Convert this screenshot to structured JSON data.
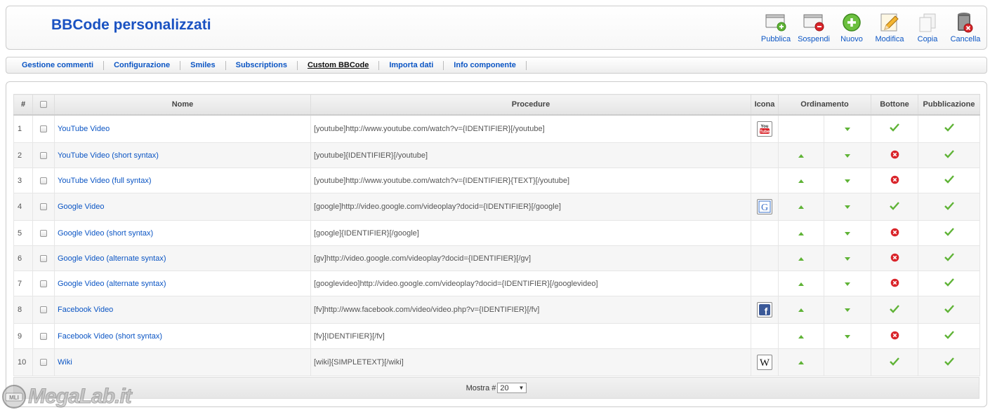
{
  "header": {
    "title": "BBCode personalizzati"
  },
  "toolbar": [
    {
      "label": "Pubblica",
      "icon": "publish-icon"
    },
    {
      "label": "Sospendi",
      "icon": "unpublish-icon"
    },
    {
      "label": "Nuovo",
      "icon": "new-icon"
    },
    {
      "label": "Modifica",
      "icon": "edit-icon"
    },
    {
      "label": "Copia",
      "icon": "copy-icon"
    },
    {
      "label": "Cancella",
      "icon": "delete-icon"
    }
  ],
  "tabs": [
    {
      "label": "Gestione commenti",
      "active": false
    },
    {
      "label": "Configurazione",
      "active": false
    },
    {
      "label": "Smiles",
      "active": false
    },
    {
      "label": "Subscriptions",
      "active": false
    },
    {
      "label": "Custom BBCode",
      "active": true
    },
    {
      "label": "Importa dati",
      "active": false
    },
    {
      "label": "Info componente",
      "active": false
    }
  ],
  "table": {
    "headers": {
      "num": "#",
      "name": "Nome",
      "procedure": "Procedure",
      "icon": "Icona",
      "order": "Ordinamento",
      "button": "Bottone",
      "published": "Pubblicazione"
    },
    "rows": [
      {
        "num": "1",
        "name": "YouTube Video",
        "procedure": "[youtube]http://www.youtube.com/watch?v={IDENTIFIER}[/youtube]",
        "icon": "youtube-icon",
        "up": false,
        "down": true,
        "button": true,
        "published": true
      },
      {
        "num": "2",
        "name": "YouTube Video (short syntax)",
        "procedure": "[youtube]{IDENTIFIER}[/youtube]",
        "icon": "",
        "up": true,
        "down": true,
        "button": false,
        "published": true
      },
      {
        "num": "3",
        "name": "YouTube Video (full syntax)",
        "procedure": "[youtube]http://www.youtube.com/watch?v={IDENTIFIER}{TEXT}[/youtube]",
        "icon": "",
        "up": true,
        "down": true,
        "button": false,
        "published": true
      },
      {
        "num": "4",
        "name": "Google Video",
        "procedure": "[google]http://video.google.com/videoplay?docid={IDENTIFIER}[/google]",
        "icon": "google-icon",
        "up": true,
        "down": true,
        "button": true,
        "published": true
      },
      {
        "num": "5",
        "name": "Google Video (short syntax)",
        "procedure": "[google]{IDENTIFIER}[/google]",
        "icon": "",
        "up": true,
        "down": true,
        "button": false,
        "published": true
      },
      {
        "num": "6",
        "name": "Google Video (alternate syntax)",
        "procedure": "[gv]http://video.google.com/videoplay?docid={IDENTIFIER}[/gv]",
        "icon": "",
        "up": true,
        "down": true,
        "button": false,
        "published": true
      },
      {
        "num": "7",
        "name": "Google Video (alternate syntax)",
        "procedure": "[googlevideo]http://video.google.com/videoplay?docid={IDENTIFIER}[/googlevideo]",
        "icon": "",
        "up": true,
        "down": true,
        "button": false,
        "published": true
      },
      {
        "num": "8",
        "name": "Facebook Video",
        "procedure": "[fv]http://www.facebook.com/video/video.php?v={IDENTIFIER}[/fv]",
        "icon": "facebook-icon",
        "up": true,
        "down": true,
        "button": true,
        "published": true
      },
      {
        "num": "9",
        "name": "Facebook Video (short syntax)",
        "procedure": "[fv]{IDENTIFIER}[/fv]",
        "icon": "",
        "up": true,
        "down": true,
        "button": false,
        "published": true
      },
      {
        "num": "10",
        "name": "Wiki",
        "procedure": "[wiki]{SIMPLETEXT}[/wiki]",
        "icon": "wikipedia-icon",
        "up": true,
        "down": false,
        "button": true,
        "published": true
      }
    ]
  },
  "pagination": {
    "label": "Mostra #",
    "value": "20"
  },
  "watermark": {
    "text": "MegaLab.it",
    "badge": "MLI"
  },
  "colors": {
    "accent": "#0b55c4",
    "title": "#1a52c2",
    "ok": "#5fb336",
    "error": "#d9242a"
  }
}
